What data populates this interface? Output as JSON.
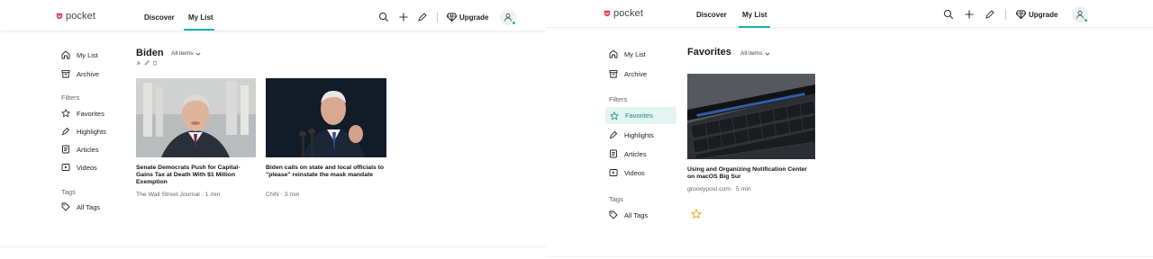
{
  "brand": {
    "name": "pocket",
    "color": "#ef4056"
  },
  "accent": "#1cb0a8",
  "nav": {
    "discover": "Discover",
    "mylist": "My List"
  },
  "upgrade": "Upgrade",
  "icons": [
    "search-icon",
    "add-icon",
    "highlight-pen-icon",
    "diamond-icon",
    "avatar-icon"
  ],
  "left": {
    "sidebar": {
      "mylist": "My List",
      "archive": "Archive",
      "filters_heading": "Filters",
      "favorites": "Favorites",
      "highlights": "Highlights",
      "articles": "Articles",
      "videos": "Videos",
      "tags_heading": "Tags",
      "alltags": "All Tags"
    },
    "title": "Biden",
    "filter": "All items",
    "cards": [
      {
        "title": "Senate Democrats Push for Capital-Gains Tax at Death With $1 Million Exemption",
        "meta": "The Wall Street Journal · 1 min"
      },
      {
        "title": "Biden calls on state and local officials to \"please\" reinstate the mask mandate",
        "meta": "CNN · 3 min"
      }
    ]
  },
  "right": {
    "sidebar": {
      "mylist": "My List",
      "archive": "Archive",
      "filters_heading": "Filters",
      "favorites": "Favorites",
      "highlights": "Highlights",
      "articles": "Articles",
      "videos": "Videos",
      "tags_heading": "Tags",
      "alltags": "All Tags"
    },
    "title": "Favorites",
    "filter": "All items",
    "cards": [
      {
        "title": "Using and Organizing Notification Center on macOS Big Sur",
        "meta": "groovypost.com · 5 min"
      }
    ]
  }
}
